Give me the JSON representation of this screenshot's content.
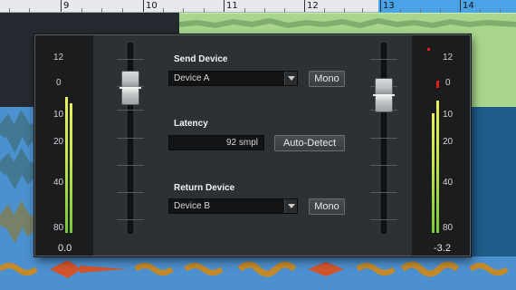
{
  "ruler": {
    "bars": [
      "9",
      "10",
      "11",
      "12",
      "13",
      "14"
    ]
  },
  "dialog": {
    "send": {
      "label": "Send Device",
      "device": "Device A",
      "mono_label": "Mono"
    },
    "latency": {
      "label": "Latency",
      "value": "92 smpl",
      "auto_detect_label": "Auto-Detect"
    },
    "return": {
      "label": "Return Device",
      "device": "Device B",
      "mono_label": "Mono"
    },
    "scale": [
      "12",
      "0",
      "10",
      "20",
      "40",
      "80"
    ],
    "left_meter": {
      "readout": "0.0",
      "level_fraction": 0.79,
      "fader_db": "0.0"
    },
    "right_meter": {
      "readout": "-3.2",
      "level_fraction": 0.77,
      "peak_red": true,
      "fader_db": "-3.2"
    },
    "colors": {
      "meter_top": "#e9f25a",
      "meter_bottom": "#79c83a",
      "peak": "#e21d1d",
      "panel_bg": "#2e3134"
    }
  }
}
